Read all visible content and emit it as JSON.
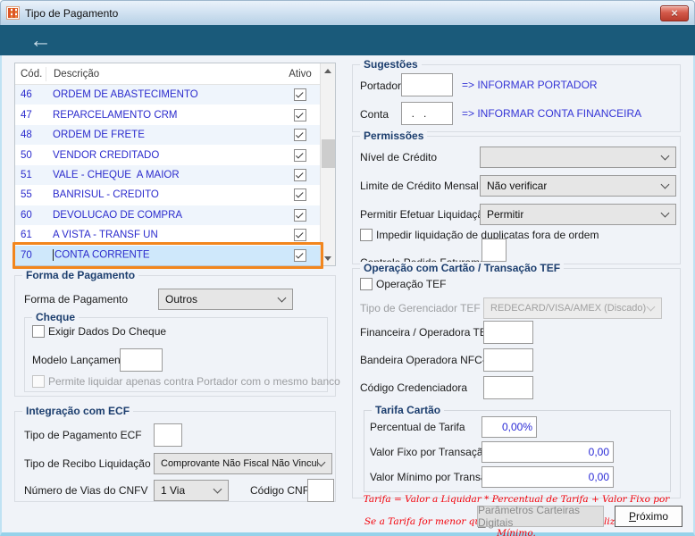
{
  "window": {
    "title": "Tipo de Pagamento"
  },
  "titlebar": {
    "close_icon": "×"
  },
  "nav": {
    "back_arrow": "←"
  },
  "payment_table": {
    "columns": {
      "cod": "Cód.",
      "descricao": "Descrição",
      "ativo": "Ativo"
    },
    "rows": [
      {
        "cod": "46",
        "descricao": "ORDEM DE ABASTECIMENTO",
        "ativo": true,
        "selected": false
      },
      {
        "cod": "47",
        "descricao": "REPARCELAMENTO CRM",
        "ativo": true,
        "selected": false
      },
      {
        "cod": "48",
        "descricao": "ORDEM DE FRETE",
        "ativo": true,
        "selected": false
      },
      {
        "cod": "50",
        "descricao": "VENDOR CREDITADO",
        "ativo": true,
        "selected": false
      },
      {
        "cod": "51",
        "descricao": "VALE - CHEQUE  A MAIOR",
        "ativo": true,
        "selected": false
      },
      {
        "cod": "55",
        "descricao": "BANRISUL - CREDITO",
        "ativo": true,
        "selected": false
      },
      {
        "cod": "60",
        "descricao": "DEVOLUCAO DE COMPRA",
        "ativo": true,
        "selected": false
      },
      {
        "cod": "61",
        "descricao": "A VISTA - TRANSF UN",
        "ativo": true,
        "selected": false
      },
      {
        "cod": "70",
        "descricao": "CONTA CORRENTE",
        "ativo": true,
        "selected": true
      }
    ],
    "highlight_color": "#f2861d"
  },
  "forma_pagamento": {
    "title": "Forma de Pagamento",
    "label": "Forma de Pagamento",
    "value": "Outros",
    "cheque": {
      "title": "Cheque",
      "exigir_dados_label": "Exigir Dados Do Cheque",
      "modelo_lancamento_label": "Modelo Lançamento",
      "modelo_lancamento_value": "",
      "permite_liquidar_label": "Permite liquidar apenas contra Portador com o mesmo banco"
    }
  },
  "integracao_ecf": {
    "title": "Integração com ECF",
    "tipo_pagamento_ecf_label": "Tipo de Pagamento ECF",
    "tipo_pagamento_ecf_value": "",
    "tipo_recibo_label": "Tipo de Recibo Liquidação",
    "tipo_recibo_value": "Comprovante Não Fiscal Não Vinculado",
    "numero_vias_label": "Número de Vias do CNFV",
    "numero_vias_value": "1 Via",
    "codigo_cnfv_label": "Código CNFV",
    "codigo_cnfv_value": ""
  },
  "sugestoes": {
    "title": "Sugestões",
    "portador_label": "Portador",
    "portador_value": "",
    "portador_hint": "=> INFORMAR PORTADOR",
    "conta_label": "Conta",
    "conta_value": "  .   .",
    "conta_hint": "=> INFORMAR CONTA FINANCEIRA"
  },
  "permissoes": {
    "title": "Permissões",
    "nivel_credito_label": "Nível de Crédito",
    "nivel_credito_value": "",
    "limite_credito_label": "Limite de Crédito Mensal",
    "limite_credito_value": "Não verificar",
    "permitir_liquidacao_label": "Permitir Efetuar Liquidação",
    "permitir_liquidacao_value": "Permitir",
    "impedir_liquidacao_label": "Impedir liquidação de duplicatas fora de ordem",
    "controle_pedido_label": "Controle Pedido Faturamento",
    "controle_pedido_value": ""
  },
  "operacao_cartao": {
    "title": "Operação com Cartão / Transação TEF",
    "operacao_tef_label": "Operação TEF",
    "gerenciador_label": "Tipo de Gerenciador TEF",
    "gerenciador_value": "REDECARD/VISA/AMEX (Discado)",
    "financeira_label": "Financeira / Operadora TEF",
    "financeira_value": "",
    "bandeira_label": "Bandeira Operadora NFC-e",
    "bandeira_value": "",
    "credenciadora_label": "Código Credenciadora",
    "credenciadora_value": "",
    "tarifa": {
      "title": "Tarifa Cartão",
      "percentual_label": "Percentual de Tarifa",
      "percentual_value": "0,00%",
      "valor_fixo_label": "Valor Fixo por Transação",
      "valor_fixo_value": "0,00",
      "valor_minimo_label": "Valor Mínimo por Transação",
      "valor_minimo_value": "0,00",
      "nota_linha1": "Tarifa = Valor a Liquidar *  Percentual de Tarifa + Valor Fixo por Transação.",
      "nota_linha2": "Se a Tarifa for menor que o Valor Mínimo, será utilizado o Valor Mínimo."
    }
  },
  "footer": {
    "parametros_button": {
      "pre": "Parâmetros Carteiras ",
      "underline": "D",
      "post": "igitais"
    },
    "proximo_button": {
      "pre": "",
      "underline": "P",
      "post": "róximo"
    }
  }
}
